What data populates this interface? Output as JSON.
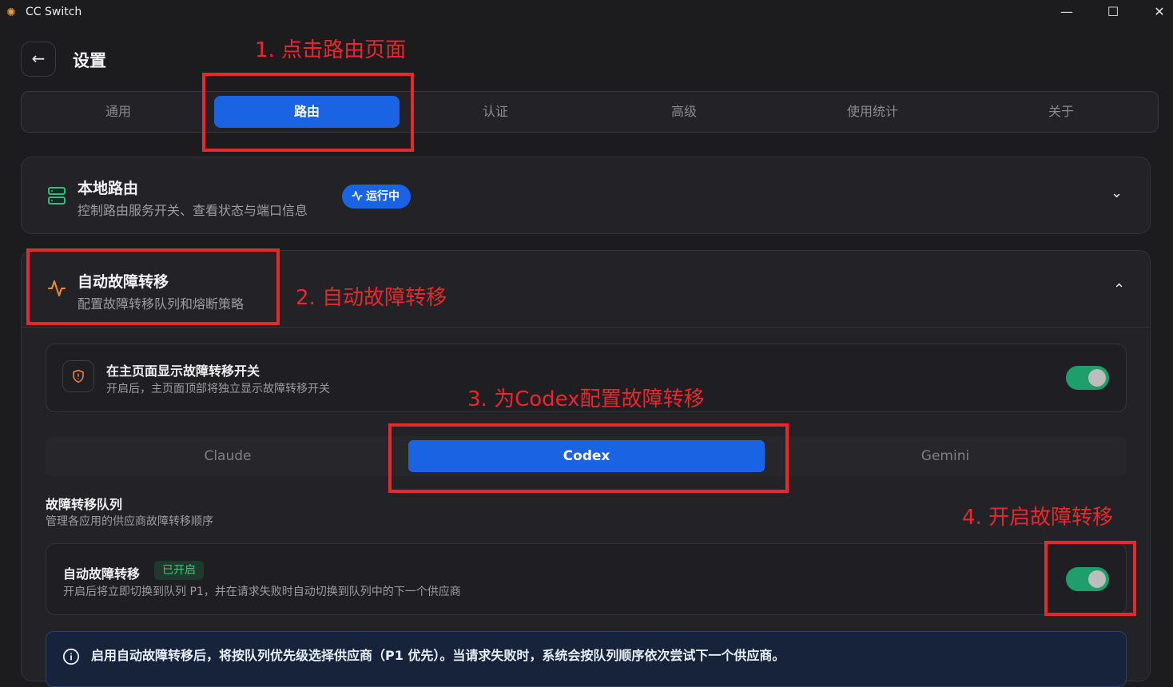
{
  "window": {
    "title": "CC Switch",
    "controls": {
      "minimize": "—",
      "maximize": "☐",
      "close": "✕"
    }
  },
  "header": {
    "back_icon": "←",
    "title": "设置"
  },
  "tabs": [
    {
      "label": "通用",
      "active": false
    },
    {
      "label": "路由",
      "active": true
    },
    {
      "label": "认证",
      "active": false
    },
    {
      "label": "高级",
      "active": false
    },
    {
      "label": "使用统计",
      "active": false
    },
    {
      "label": "关于",
      "active": false
    }
  ],
  "local_routing": {
    "icon": "server-icon",
    "title": "本地路由",
    "subtitle": "控制路由服务开关、查看状态与端口信息",
    "badge": "运行中",
    "expanded": false
  },
  "failover": {
    "icon": "activity-icon",
    "title": "自动故障转移",
    "subtitle": "配置故障转移队列和熔断策略",
    "expanded": true,
    "show_toggle_setting": {
      "title": "在主页面显示故障转移开关",
      "description": "开启后，主页面顶部将独立显示故障转移开关",
      "enabled": true
    },
    "app_tabs": [
      {
        "label": "Claude",
        "active": false
      },
      {
        "label": "Codex",
        "active": true
      },
      {
        "label": "Gemini",
        "active": false
      }
    ],
    "queue": {
      "title": "故障转移队列",
      "subtitle": "管理各应用的供应商故障转移顺序"
    },
    "auto_failover": {
      "title": "自动故障转移",
      "status": "已开启",
      "description": "开启后将立即切换到队列 P1，并在请求失败时自动切换到队列中的下一个供应商",
      "enabled": true
    },
    "info": "启用自动故障转移后，将按队列优先级选择供应商（P1 优先）。当请求失败时，系统会按队列顺序依次尝试下一个供应商。"
  },
  "annotations": [
    "1. 点击路由页面",
    "2. 自动故障转移",
    "3. 为Codex配置故障转移",
    "4. 开启故障转移"
  ],
  "colors": {
    "background": "#1c1c1f",
    "accent": "#1a64e4",
    "toggle_on": "#1e9e6a",
    "annotation": "#e8282d",
    "success_text": "#3ec57f",
    "failover_icon": "#f08c2c",
    "routing_icon": "#2fbf7a"
  }
}
